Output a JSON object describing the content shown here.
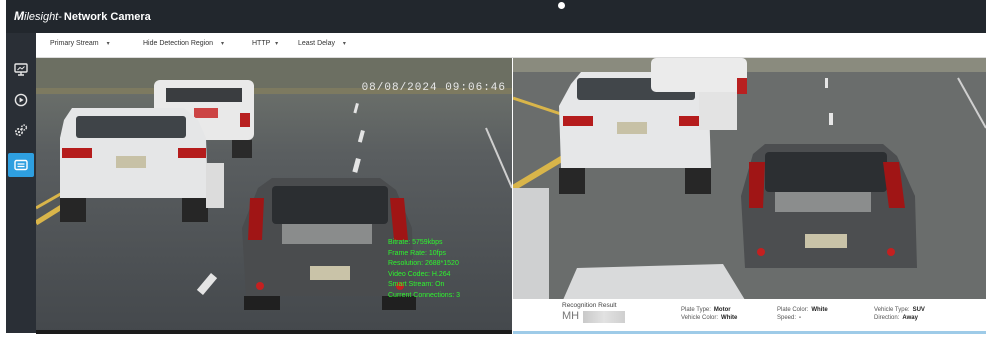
{
  "app": {
    "brand_m": "M",
    "brand_rest": "ilesight",
    "title": "Network Camera"
  },
  "toolbar": {
    "stream": "Primary Stream",
    "region": "Hide Detection Region",
    "protocol": "HTTP",
    "delay": "Least Delay"
  },
  "sidebar": {
    "items": [
      {
        "icon": "monitor-icon",
        "active": false
      },
      {
        "icon": "playback-icon",
        "active": false
      },
      {
        "icon": "settings-gear-icon",
        "active": false
      },
      {
        "icon": "lpr-plate-icon",
        "active": true
      }
    ],
    "accent": "#2e9fe0"
  },
  "live_view": {
    "timestamp": "08/08/2024 09:06:46",
    "info": {
      "bitrate": "Bitrate: 5759kbps",
      "frame_rate": "Frame Rate: 10fps",
      "resolution": "Resolution: 2688*1520",
      "codec": "Video Codec: H.264",
      "smart_stream": "Smart Stream: On",
      "connections": "Current Connections: 3"
    },
    "overlay_color": "#2ef52e"
  },
  "recognition": {
    "label": "Recognition Result",
    "plate": "MH",
    "plate_type": {
      "key": "Plate Type:",
      "value": "Motor"
    },
    "vehicle_color": {
      "key": "Vehicle Color:",
      "value": "White"
    },
    "plate_color": {
      "key": "Plate Color:",
      "value": "White"
    },
    "speed": {
      "key": "Speed:",
      "value": "-"
    },
    "vehicle_type": {
      "key": "Vehicle Type:",
      "value": "SUV"
    },
    "direction": {
      "key": "Direction:",
      "value": "Away"
    }
  }
}
